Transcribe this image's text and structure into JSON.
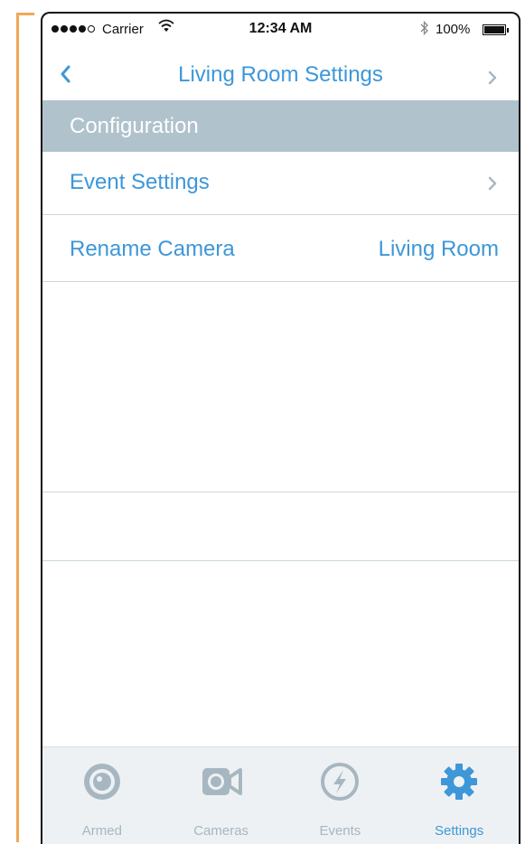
{
  "status_bar": {
    "carrier": "Carrier",
    "time": "12:34 AM",
    "battery": "100%",
    "signal_bars_filled": 4,
    "signal_bars_total": 5
  },
  "nav": {
    "title": "Living Room Settings",
    "back_icon": "chevron-left-icon",
    "forward_icon": "chevron-right-icon"
  },
  "section": {
    "header": "Configuration"
  },
  "rows": {
    "event_settings": {
      "label": "Event Settings",
      "icon": "chevron-right-icon"
    },
    "rename_camera": {
      "label": "Rename Camera",
      "value": "Living Room"
    }
  },
  "tabs": [
    {
      "label": "Armed",
      "icon": "armed-icon",
      "active": false
    },
    {
      "label": "Cameras",
      "icon": "camera-icon",
      "active": false
    },
    {
      "label": "Events",
      "icon": "events-icon",
      "active": false
    },
    {
      "label": "Settings",
      "icon": "gear-icon",
      "active": true
    }
  ],
  "colors": {
    "accent": "#3d97d8",
    "section_header_bg": "#b0c2cc",
    "tab_bar_bg": "#eef1f3",
    "tab_inactive": "#a7b7c1",
    "annotation_bracket": "#f0a858"
  }
}
